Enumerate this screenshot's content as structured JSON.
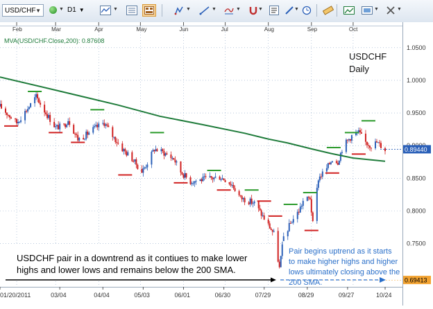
{
  "toolbar": {
    "symbol": "USD/CHF",
    "period": "D1",
    "icons": [
      "status-ball-icon",
      "line-chart-icon",
      "chart-type-icon",
      "chart-properties-icon",
      "linked-charts-icon",
      "draw-tool-icon",
      "indicator-icon",
      "magnet-icon",
      "text-tool-icon",
      "pen-icon",
      "timer-icon",
      "ruler-icon",
      "screenshot-icon",
      "image-icon",
      "tools-icon"
    ]
  },
  "indicator_label": "MVA(USD/CHF.Close,200): 0.87608",
  "chart_title": {
    "line1": "USDCHF",
    "line2": "Daily"
  },
  "top_months": [
    "Feb",
    "Mar",
    "Apr",
    "May",
    "Jun",
    "Jul",
    "Aug",
    "Sep",
    "Oct"
  ],
  "price_ticks": [
    "1.0500",
    "1.0000",
    "0.9500",
    "0.9000",
    "0.8500",
    "0.8000",
    "0.7500"
  ],
  "date_ticks": [
    "01/20/2011",
    "03/04",
    "04/04",
    "05/03",
    "06/01",
    "06/30",
    "07/29",
    "08/29",
    "09/27",
    "10/24"
  ],
  "current_price": "0.89440",
  "low_price": "0.69413",
  "annotations": {
    "downtrend": "USDCHF pair in a downtrend as it contiues to make lower highs and lower lows and remains below the 200 SMA.",
    "uptrend": "Pair begins uptrend as it starts to make higher highs and higher lows ultimately closing above the 200 SMA."
  },
  "colors": {
    "sma": "#1e7b3a",
    "bull": "#2a5fb8",
    "bear": "#d02020",
    "high_marker": "#2a9a2a",
    "low_marker": "#d02020",
    "current_price_bg": "#2a5fb8",
    "low_price_bg": "#f3a331",
    "uptrend_text": "#2a6fc9",
    "grid": "#8fa8c8"
  },
  "chart_data": {
    "type": "candlestick",
    "instrument": "USD/CHF",
    "timeframe": "D1",
    "ylim": [
      0.69,
      1.07
    ],
    "x_range": [
      "2011-01-20",
      "2011-10-24"
    ],
    "price_path": [
      [
        "2011-01-20",
        0.96
      ],
      [
        "2011-02-01",
        0.935
      ],
      [
        "2011-02-10",
        0.96
      ],
      [
        "2011-02-15",
        0.975
      ],
      [
        "2011-02-22",
        0.95
      ],
      [
        "2011-03-01",
        0.928
      ],
      [
        "2011-03-07",
        0.93
      ],
      [
        "2011-03-10",
        0.94
      ],
      [
        "2011-03-17",
        0.91
      ],
      [
        "2011-03-22",
        0.915
      ],
      [
        "2011-03-28",
        0.925
      ],
      [
        "2011-04-05",
        0.935
      ],
      [
        "2011-04-11",
        0.915
      ],
      [
        "2011-04-18",
        0.895
      ],
      [
        "2011-04-25",
        0.88
      ],
      [
        "2011-05-02",
        0.86
      ],
      [
        "2011-05-05",
        0.87
      ],
      [
        "2011-05-11",
        0.895
      ],
      [
        "2011-05-17",
        0.89
      ],
      [
        "2011-05-25",
        0.88
      ],
      [
        "2011-05-30",
        0.86
      ],
      [
        "2011-06-06",
        0.845
      ],
      [
        "2011-06-14",
        0.848
      ],
      [
        "2011-06-21",
        0.85
      ],
      [
        "2011-06-27",
        0.852
      ],
      [
        "2011-07-01",
        0.848
      ],
      [
        "2011-07-06",
        0.84
      ],
      [
        "2011-07-12",
        0.82
      ],
      [
        "2011-07-18",
        0.815
      ],
      [
        "2011-07-22",
        0.812
      ],
      [
        "2011-07-27",
        0.795
      ],
      [
        "2011-08-02",
        0.775
      ],
      [
        "2011-08-05",
        0.765
      ],
      [
        "2011-08-09",
        0.712
      ],
      [
        "2011-08-12",
        0.76
      ],
      [
        "2011-08-18",
        0.785
      ],
      [
        "2011-08-23",
        0.8
      ],
      [
        "2011-08-26",
        0.815
      ],
      [
        "2011-08-31",
        0.82
      ],
      [
        "2011-09-02",
        0.78
      ],
      [
        "2011-09-06",
        0.85
      ],
      [
        "2011-09-12",
        0.865
      ],
      [
        "2011-09-16",
        0.88
      ],
      [
        "2011-09-20",
        0.875
      ],
      [
        "2011-09-23",
        0.895
      ],
      [
        "2011-09-26",
        0.905
      ],
      [
        "2011-09-30",
        0.915
      ],
      [
        "2011-10-05",
        0.92
      ],
      [
        "2011-10-10",
        0.905
      ],
      [
        "2011-10-14",
        0.9
      ],
      [
        "2011-10-18",
        0.905
      ],
      [
        "2011-10-24",
        0.894
      ]
    ],
    "sma_200": [
      [
        "2011-01-20",
        1.005
      ],
      [
        "2011-03-01",
        0.985
      ],
      [
        "2011-04-15",
        0.962
      ],
      [
        "2011-05-15",
        0.945
      ],
      [
        "2011-06-15",
        0.932
      ],
      [
        "2011-07-15",
        0.919
      ],
      [
        "2011-08-01",
        0.91
      ],
      [
        "2011-08-15",
        0.904
      ],
      [
        "2011-09-01",
        0.895
      ],
      [
        "2011-09-15",
        0.888
      ],
      [
        "2011-10-01",
        0.881
      ],
      [
        "2011-10-24",
        0.876
      ]
    ],
    "swing_highs": [
      [
        "2011-02-14",
        0.983
      ],
      [
        "2011-03-31",
        0.955
      ],
      [
        "2011-05-13",
        0.92
      ],
      [
        "2011-06-23",
        0.862
      ],
      [
        "2011-07-20",
        0.832
      ],
      [
        "2011-08-17",
        0.81
      ],
      [
        "2011-08-31",
        0.828
      ],
      [
        "2011-09-17",
        0.897
      ],
      [
        "2011-09-30",
        0.92
      ],
      [
        "2011-10-12",
        0.938
      ]
    ],
    "swing_lows": [
      [
        "2011-01-28",
        0.93
      ],
      [
        "2011-03-01",
        0.92
      ],
      [
        "2011-03-17",
        0.905
      ],
      [
        "2011-04-20",
        0.855
      ],
      [
        "2011-05-30",
        0.843
      ],
      [
        "2011-06-30",
        0.832
      ],
      [
        "2011-07-29",
        0.815
      ],
      [
        "2011-08-06",
        0.792
      ],
      [
        "2011-09-01",
        0.77
      ],
      [
        "2011-09-16",
        0.858
      ],
      [
        "2011-10-05",
        0.887
      ]
    ]
  }
}
